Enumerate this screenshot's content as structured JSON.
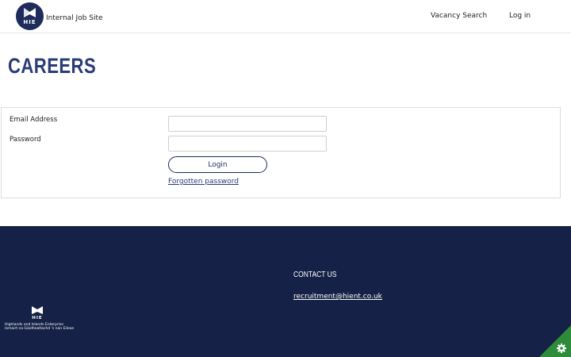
{
  "header": {
    "logo_text": "HIE",
    "site_name": "Internal Job Site",
    "nav": {
      "vacancy_search": "Vacancy Search",
      "log_in": "Log in"
    }
  },
  "main": {
    "title": "CAREERS",
    "form": {
      "email_label": "Email Address",
      "email_value": "",
      "password_label": "Password",
      "password_value": "",
      "login_button": "Login",
      "forgotten_password": "Forgotten password"
    }
  },
  "footer": {
    "logo_text": "HIE",
    "org_name_en": "Highlands and Islands Enterprise",
    "org_name_gd": "Iomairt na Gàidhealtachd 's nan Eilean",
    "contact_title": "CONTACT US",
    "contact_email": "recruitment@hient.co.uk",
    "cookie_icon": "gear-icon"
  },
  "colors": {
    "brand_navy": "#1f2b5b",
    "title_blue": "#2a3c78",
    "footer_bg": "#152146",
    "cookie_green": "#2e8b3a"
  }
}
